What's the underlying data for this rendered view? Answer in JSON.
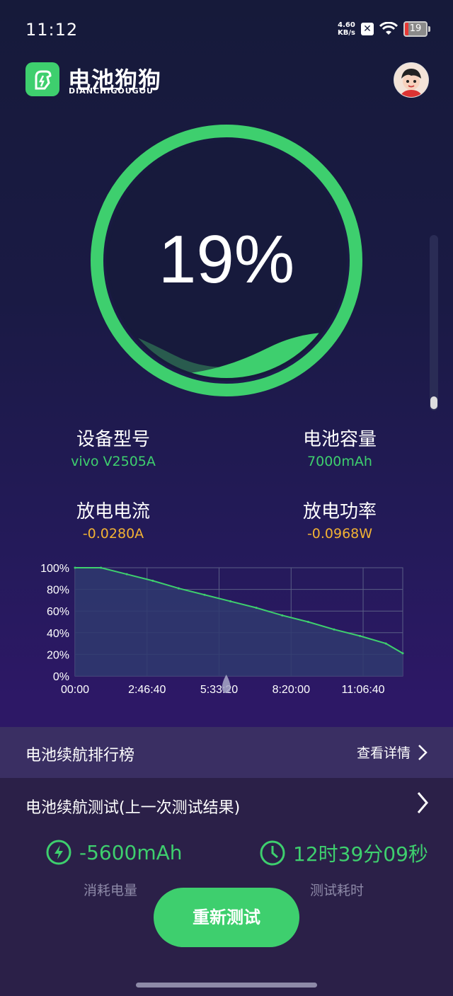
{
  "status": {
    "time": "11:12",
    "speed_value": "4.60",
    "speed_unit": "KB/s",
    "battery": "19"
  },
  "app": {
    "title": "电池狗狗",
    "subtitle": "DIANCHIGOUGOU"
  },
  "gauge": {
    "percent": "19%",
    "level": 0.19,
    "color": "#3ecf6e"
  },
  "info": {
    "device_label": "设备型号",
    "device_value": "vivo V2505A",
    "capacity_label": "电池容量",
    "capacity_value": "7000mAh",
    "current_label": "放电电流",
    "current_value": "-0.0280A",
    "power_label": "放电功率",
    "power_value": "-0.0968W"
  },
  "chart_data": {
    "type": "area",
    "y_ticks": [
      "100%",
      "80%",
      "60%",
      "40%",
      "20%",
      "0%"
    ],
    "x_ticks": [
      "00:00",
      "2:46:40",
      "5:33:20",
      "8:20:00",
      "11:06:40"
    ],
    "x_hours": [
      0,
      1,
      2,
      3,
      4,
      5,
      6,
      7,
      8,
      9,
      10,
      11,
      12,
      12.65
    ],
    "values": [
      100,
      100,
      94,
      88,
      81,
      75,
      69,
      63,
      56,
      50,
      43,
      37,
      30,
      21
    ],
    "xlim": [
      0,
      12.65
    ],
    "ylim": [
      0,
      100
    ],
    "line_color": "#3ecf6e",
    "grid": true
  },
  "ranking": {
    "title": "电池续航排行榜",
    "detail": "查看详情"
  },
  "test": {
    "title": "电池续航测试(上一次测试结果)",
    "consumed_value": "-5600mAh",
    "consumed_label": "消耗电量",
    "duration_value": "12时39分09秒",
    "duration_label": "测试耗时",
    "retest_button": "重新测试"
  }
}
